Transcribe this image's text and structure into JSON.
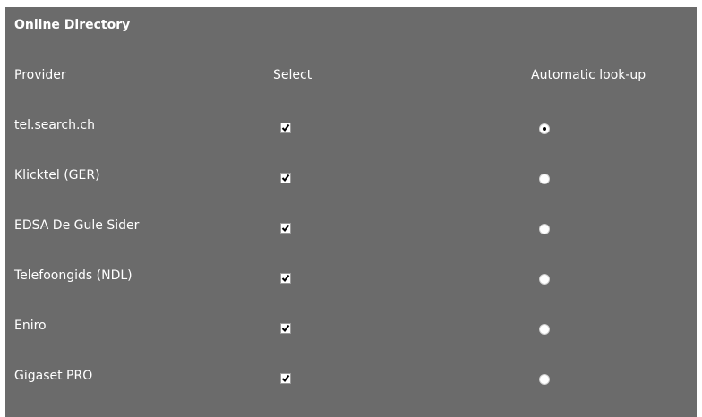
{
  "panel": {
    "title": "Online Directory"
  },
  "columns": {
    "provider": "Provider",
    "select": "Select",
    "automatic": "Automatic look-up"
  },
  "providers": [
    {
      "name": "tel.search.ch",
      "selected": true,
      "automatic": true
    },
    {
      "name": "Klicktel (GER)",
      "selected": true,
      "automatic": false
    },
    {
      "name": "EDSA De Gule Sider",
      "selected": true,
      "automatic": false
    },
    {
      "name": "Telefoongids (NDL)",
      "selected": true,
      "automatic": false
    },
    {
      "name": "Eniro",
      "selected": true,
      "automatic": false
    },
    {
      "name": "Gigaset PRO",
      "selected": true,
      "automatic": false
    }
  ],
  "colors": {
    "panel_background": "#6b6b6b",
    "text": "#ffffff"
  }
}
